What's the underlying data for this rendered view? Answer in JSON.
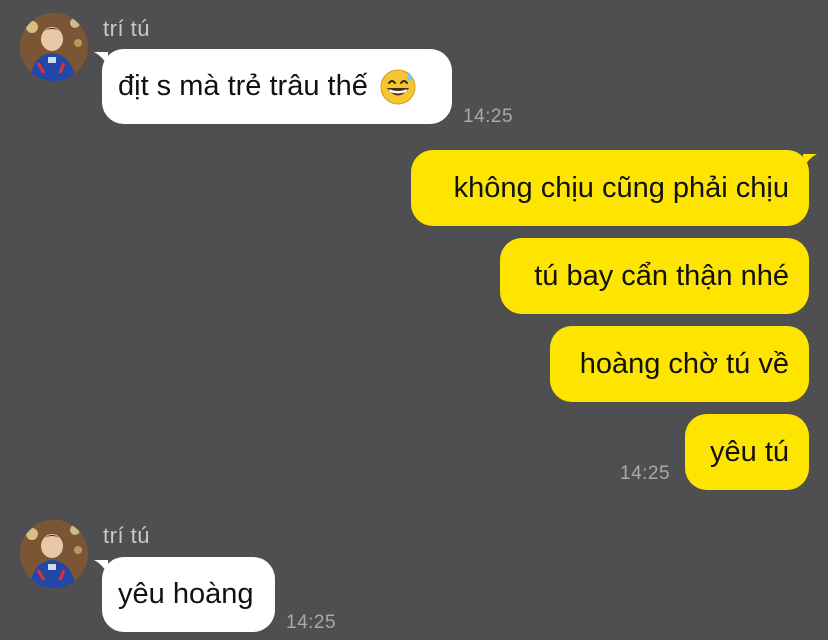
{
  "chat": {
    "messages": [
      {
        "sender": "trí tú",
        "text": "địt s mà trẻ trâu thế",
        "emoji": "grinning-sweat-emoji",
        "time": "14:25"
      },
      {
        "outgoing": [
          "không chịu cũng phải chịu",
          "tú bay cẩn thận nhé",
          "hoàng chờ tú về",
          "yêu tú"
        ],
        "time": "14:25"
      },
      {
        "sender": "trí tú",
        "text": "yêu hoàng",
        "time": "14:25"
      }
    ]
  },
  "colors": {
    "background": "#4f4e50",
    "incoming_bubble": "#ffffff",
    "outgoing_bubble": "#fee500",
    "sender_text": "#c9c9c9",
    "time_text": "#a9a9a9"
  }
}
